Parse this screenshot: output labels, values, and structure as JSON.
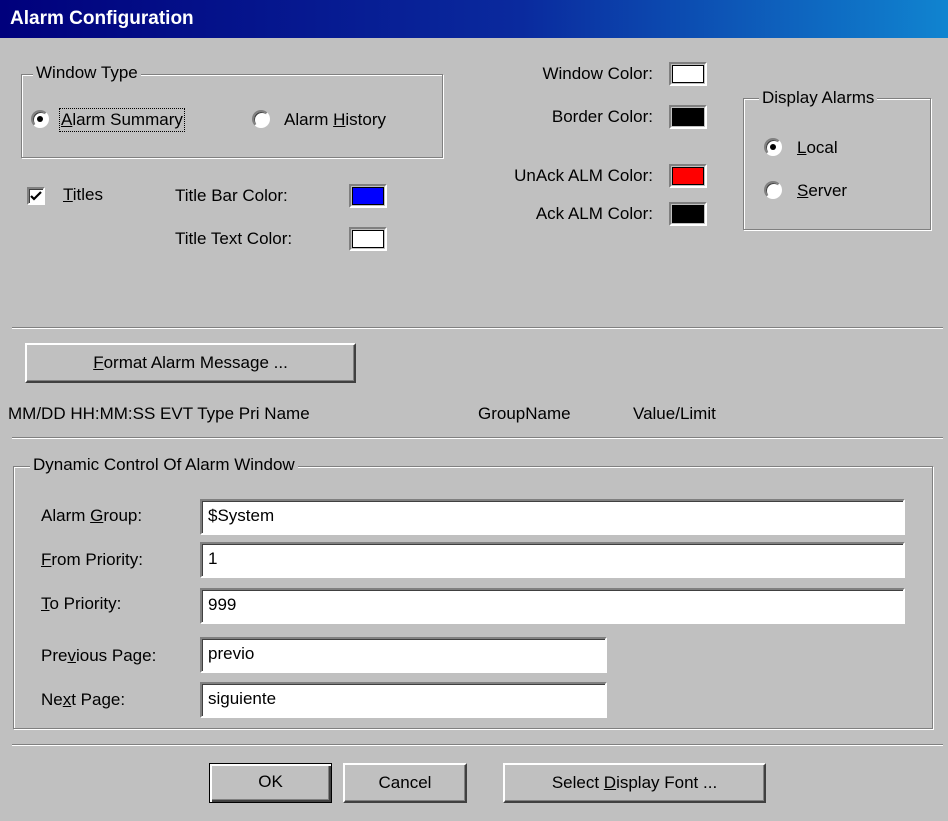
{
  "window": {
    "title": "Alarm Configuration"
  },
  "window_type": {
    "legend": "Window Type",
    "options": [
      {
        "label": "Alarm Summary",
        "selected": true
      },
      {
        "label": "Alarm History",
        "selected": false
      }
    ]
  },
  "titles_checkbox": {
    "label": "Titles",
    "checked": true
  },
  "colors": {
    "title_bar": {
      "label": "Title Bar Color:",
      "value": "#0000ff"
    },
    "title_text": {
      "label": "Title Text Color:",
      "value": "#ffffff"
    },
    "window": {
      "label": "Window Color:",
      "value": "#ffffff"
    },
    "border": {
      "label": "Border Color:",
      "value": "#000000"
    },
    "unack_alm": {
      "label": "UnAck ALM Color:",
      "value": "#ff0000"
    },
    "ack_alm": {
      "label": "Ack ALM Color:",
      "value": "#000000"
    }
  },
  "display_alarms": {
    "legend": "Display Alarms",
    "options": [
      {
        "label": "Local",
        "selected": true
      },
      {
        "label": "Server",
        "selected": false
      }
    ]
  },
  "format_button": {
    "label": "Format Alarm Message ..."
  },
  "format_preview": {
    "fields": "MM/DD HH:MM:SS EVT Type Pri Name",
    "group": "GroupName",
    "value": "Value/Limit"
  },
  "dynamic_control": {
    "legend": "Dynamic Control Of Alarm Window",
    "alarm_group": {
      "label": "Alarm Group:",
      "value": "$System"
    },
    "from_priority": {
      "label": "From Priority:",
      "value": "1"
    },
    "to_priority": {
      "label": "To Priority:",
      "value": "999"
    },
    "previous_page": {
      "label": "Previous Page:",
      "value": "previo"
    },
    "next_page": {
      "label": "Next Page:",
      "value": "siguiente"
    }
  },
  "buttons": {
    "ok": "OK",
    "cancel": "Cancel",
    "select_font": "Select Display Font ..."
  }
}
